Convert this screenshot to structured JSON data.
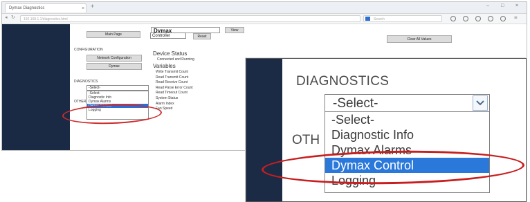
{
  "browser": {
    "tab_title": "Dymax Diagnostics",
    "tab_close": "×",
    "new_tab": "+",
    "url": "192.168.1.1/diagnostics.html",
    "search_placeholder": "Search",
    "window_controls": [
      "–",
      "□",
      "×"
    ]
  },
  "page": {
    "main_page_button": "Main Page",
    "configuration_heading": "CONFIGURATION",
    "network_config_button": "Network Configuration",
    "dymax_button": "Dymax",
    "diagnostics_heading": "DIAGNOSTICS",
    "other_heading": "OTHER",
    "device_select_value": "Dymax",
    "view_button": "View",
    "controller_select_value": "Controller",
    "reset_button": "Reset",
    "clear_all_button": "Clear All Values",
    "device_status_heading": "Device Status",
    "device_status_value": "Connected and Running",
    "variables_heading": "Variables",
    "variables": [
      "Write Transmit Count",
      "Read Transmit Count",
      "Read Receive Count",
      "Read Parse Error Count",
      "Read Timeout Count",
      "System Status",
      "Alarm Index",
      "Fan Speed"
    ]
  },
  "diagnostics": {
    "heading": "DIAGNOSTICS",
    "other_heading": "OTH",
    "selected": "-Select-",
    "options": [
      "-Select-",
      "Diagnostic Info",
      "Dymax Alarms",
      "Dymax Control",
      "Logging"
    ],
    "highlighted_option": "Dymax Control"
  },
  "colors": {
    "sidebar": "#1b2b46",
    "highlight": "#2a78d9",
    "annotation": "#c81e1e"
  }
}
